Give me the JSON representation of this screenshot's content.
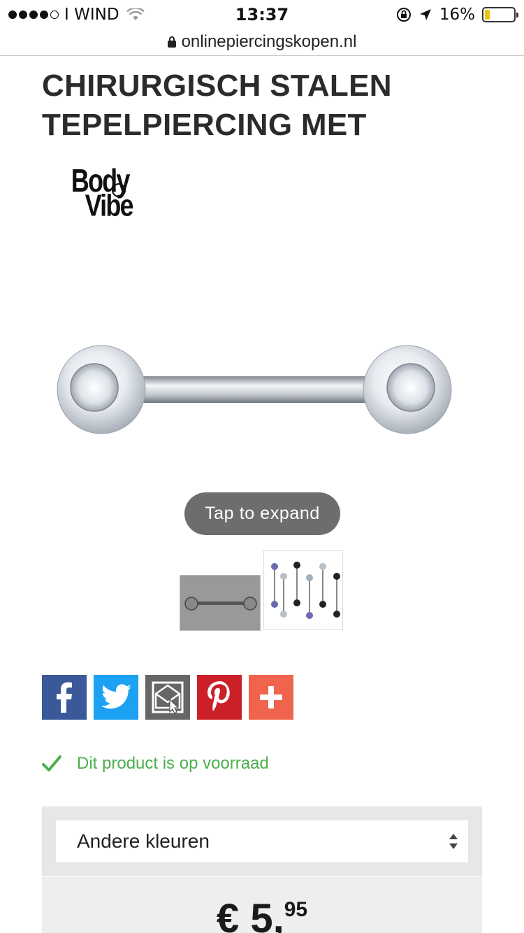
{
  "status_bar": {
    "carrier": "I WIND",
    "time": "13:37",
    "battery_percent": "16%",
    "battery_level": 0.16
  },
  "url_bar": {
    "domain": "onlinepiercingskopen.nl"
  },
  "product": {
    "title": "CHIRURGISCH STALEN TEPELPIERCING MET",
    "brand_logo_text": "Body Vibe",
    "tap_to_expand": "Tap to expand",
    "stock_message": "Dit product is op voorraad",
    "variant_select": "Andere kleuren",
    "price_currency": "€",
    "price_whole": "5",
    "price_cents": "95"
  },
  "share_buttons": [
    {
      "name": "facebook",
      "color": "#3b5998"
    },
    {
      "name": "twitter",
      "color": "#1da1f2"
    },
    {
      "name": "email",
      "color": "#666666"
    },
    {
      "name": "pinterest",
      "color": "#cb2027"
    },
    {
      "name": "more",
      "color": "#f0634c"
    }
  ],
  "colors": {
    "stock_green": "#4cae4c",
    "tap_bg": "#6d6d70"
  }
}
